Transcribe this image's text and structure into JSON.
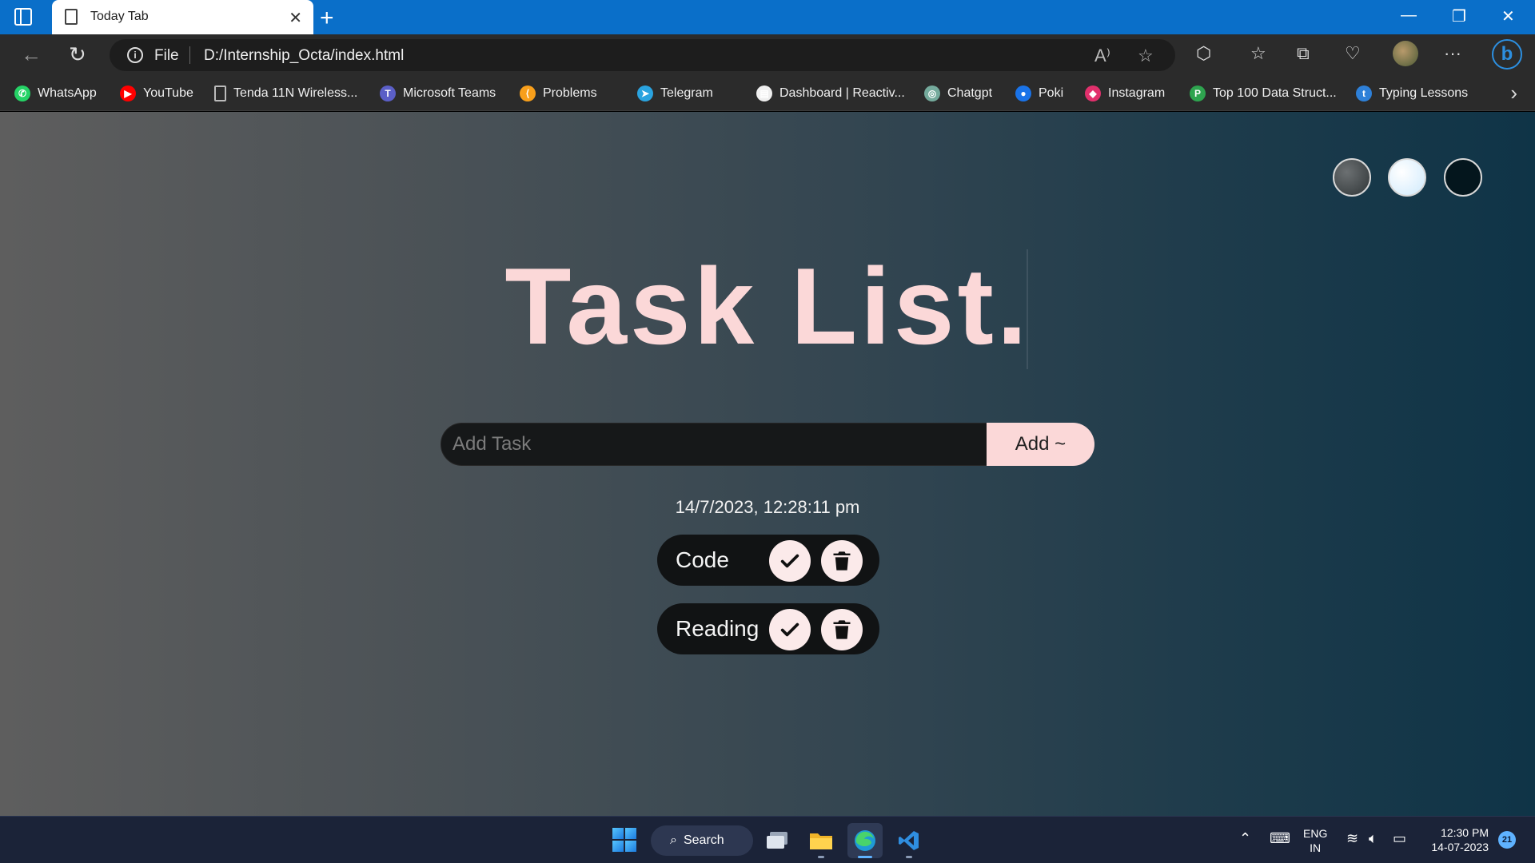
{
  "browser": {
    "tab_title": "Today Tab",
    "tab_close": "✕",
    "new_tab": "+",
    "window_controls": {
      "minimize": "—",
      "restore": "❐",
      "close": "✕"
    },
    "address": {
      "scheme_label": "File",
      "url": "D:/Internship_Octa/index.html"
    },
    "bookmarks": [
      {
        "label": "WhatsApp",
        "icon": "whatsapp-icon",
        "color": "#25d366"
      },
      {
        "label": "YouTube",
        "icon": "youtube-icon",
        "color": "#ff0000"
      },
      {
        "label": "Tenda 11N Wireless...",
        "icon": "page-icon",
        "color": "#bbbbbb"
      },
      {
        "label": "Microsoft Teams",
        "icon": "teams-icon",
        "color": "#5b5fc7"
      },
      {
        "label": "Problems",
        "icon": "leetcode-icon",
        "color": "#f89f1b"
      },
      {
        "label": "Telegram",
        "icon": "telegram-icon",
        "color": "#2aa3df"
      },
      {
        "label": "Dashboard | Reactiv...",
        "icon": "dashboard-icon",
        "color": "#eeeeee"
      },
      {
        "label": "Chatgpt",
        "icon": "chatgpt-icon",
        "color": "#74aa9c"
      },
      {
        "label": "Poki",
        "icon": "poki-icon",
        "color": "#1a73e8"
      },
      {
        "label": "Instagram",
        "icon": "instagram-icon",
        "color": "#e1306c"
      },
      {
        "label": "Top 100 Data Struct...",
        "icon": "guide-icon",
        "color": "#2ea44f"
      },
      {
        "label": "Typing Lessons",
        "icon": "typing-icon",
        "color": "#2e80d8"
      }
    ]
  },
  "app": {
    "heading": "Task List.",
    "input_placeholder": "Add Task",
    "add_button": "Add ~",
    "datetime": "14/7/2023, 12:28:11 pm",
    "tasks": [
      {
        "label": "Code"
      },
      {
        "label": "Reading"
      }
    ],
    "theme_colors": [
      "#555a5c",
      "#e8f6ff",
      "#04161d"
    ],
    "accent_color": "#fbd8d8"
  },
  "taskbar": {
    "search_label": "Search",
    "language": "ENG",
    "region": "IN",
    "time": "12:30 PM",
    "date": "14-07-2023",
    "notification_count": "21"
  }
}
